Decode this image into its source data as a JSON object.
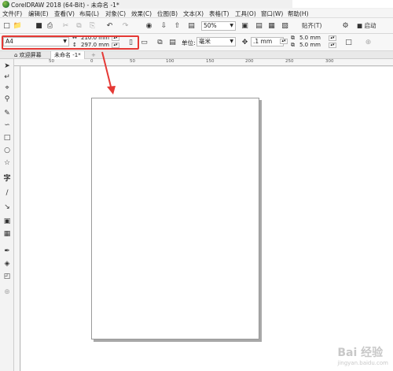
{
  "window": {
    "title": "CorelDRAW 2018 (64-Bit) - 未命名 -1*"
  },
  "menu": {
    "items": [
      "文件(F)",
      "编辑(E)",
      "查看(V)",
      "布局(L)",
      "对象(C)",
      "效果(C)",
      "位图(B)",
      "文本(X)",
      "表格(T)",
      "工具(O)",
      "窗口(W)",
      "帮助(H)"
    ]
  },
  "toolbar": {
    "zoom": "50%",
    "snap_label": "贴齐(T)",
    "launch_label": "启动"
  },
  "property_bar": {
    "page_size": "A4",
    "width": "210.0 mm",
    "height": "297.0 mm",
    "unit_label": "单位:",
    "unit": "毫米",
    "nudge": ".1 mm",
    "dup_x": "5.0 mm",
    "dup_y": "5.0 mm"
  },
  "tabs": {
    "welcome": "欢迎屏幕",
    "document": "未命名 -1*"
  },
  "ruler": {
    "h_numbers": [
      "50",
      "0",
      "50",
      "100",
      "150",
      "200",
      "250",
      "300"
    ]
  },
  "watermark": {
    "text": "Bai 经验",
    "sub": "jingyan.baidu.com"
  }
}
